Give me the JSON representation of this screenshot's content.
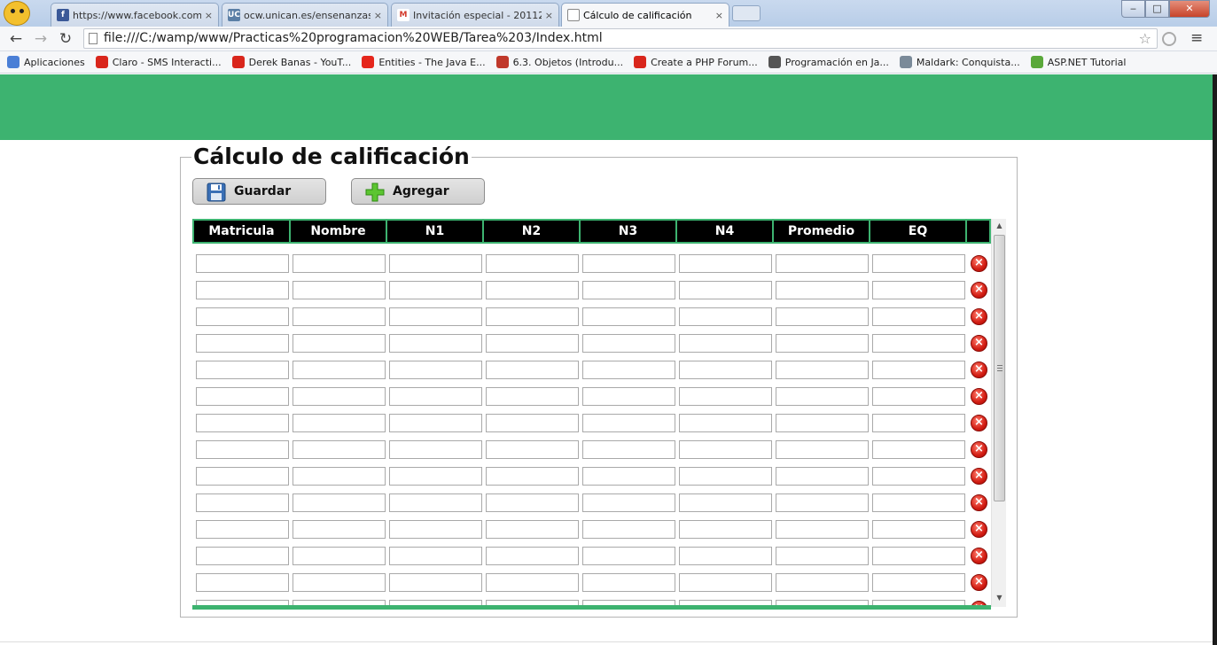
{
  "browser": {
    "tabs": [
      {
        "title": "https://www.facebook.com",
        "active": false,
        "icon": "facebook-icon",
        "color": "#3b5998",
        "glyph": "f"
      },
      {
        "title": "ocw.unican.es/ensenanzas",
        "active": false,
        "icon": "unican-icon",
        "color": "#5b7fa6",
        "glyph": "UC"
      },
      {
        "title": "Invitación especial - 20112",
        "active": false,
        "icon": "gmail-icon",
        "color": "#d33b2c",
        "glyph": "M"
      },
      {
        "title": "Cálculo de calificación",
        "active": true,
        "icon": "page-icon",
        "color": "#ffffff",
        "glyph": ""
      }
    ],
    "address": "file:///C:/wamp/www/Practicas%20programacion%20WEB/Tarea%203/Index.html",
    "bookmarks": [
      {
        "label": "Aplicaciones",
        "icon": "apps-icon",
        "color": "#4a7fd6"
      },
      {
        "label": "Claro - SMS Interacti...",
        "icon": "claro-icon",
        "color": "#d9261c"
      },
      {
        "label": "Derek Banas - YouT...",
        "icon": "youtube-icon",
        "color": "#d9261c"
      },
      {
        "label": "Entities - The Java E...",
        "icon": "oracle-icon",
        "color": "#e5261c"
      },
      {
        "label": "6.3. Objetos (Introdu...",
        "icon": "bookmark-icon",
        "color": "#c0392b"
      },
      {
        "label": "Create a PHP Forum...",
        "icon": "youtube-icon",
        "color": "#d9261c"
      },
      {
        "label": "Programación en Ja...",
        "icon": "wave-icon",
        "color": "#555555"
      },
      {
        "label": "Maldark: Conquista...",
        "icon": "bird-icon",
        "color": "#7a8a99"
      },
      {
        "label": "ASP.NET Tutorial",
        "icon": "aspnet-icon",
        "color": "#5aa83a"
      }
    ]
  },
  "colors": {
    "header_green": "#3db370",
    "delete_red": "#d11c12"
  },
  "form": {
    "legend": "Cálculo de calificación",
    "save_label": "Guardar",
    "add_label": "Agregar",
    "columns": [
      "Matricula",
      "Nombre",
      "N1",
      "N2",
      "N3",
      "N4",
      "Promedio",
      "EQ"
    ],
    "row_count": 14
  }
}
